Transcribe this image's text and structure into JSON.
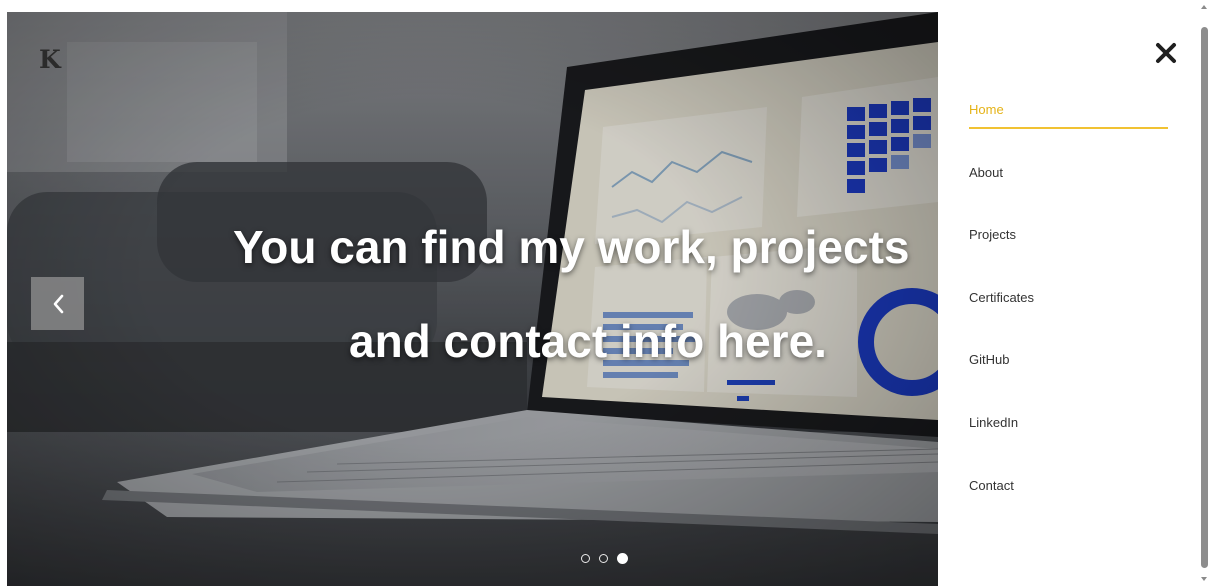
{
  "brand": {
    "logo_text": "K"
  },
  "hero": {
    "caption_line_1": "You can find my work, projects",
    "caption_line_2": "and contact info here.",
    "prev_icon": "chevron-left-icon",
    "indicators": [
      {
        "active": false
      },
      {
        "active": false
      },
      {
        "active": true
      }
    ]
  },
  "nav": {
    "close_icon": "close-icon",
    "accent_color": "#f1c232",
    "items": [
      {
        "label": "Home",
        "active": true
      },
      {
        "label": "About",
        "active": false
      },
      {
        "label": "Projects",
        "active": false
      },
      {
        "label": "Certificates",
        "active": false
      },
      {
        "label": "GitHub",
        "active": false
      },
      {
        "label": "LinkedIn",
        "active": false
      },
      {
        "label": "Contact",
        "active": false
      }
    ]
  }
}
